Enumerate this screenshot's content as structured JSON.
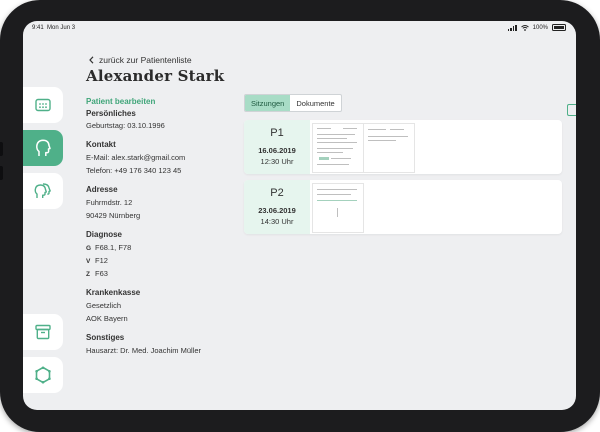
{
  "status": {
    "time": "9:41",
    "date": "Mon Jun 3",
    "battery": "100%"
  },
  "nav": {
    "back_label": "zurück zur Patientenliste",
    "patient_name": "Alexander Stark"
  },
  "sidebar": {
    "items": [
      {
        "icon": "calendar-icon",
        "active": false
      },
      {
        "icon": "head-profile-icon",
        "active": true
      },
      {
        "icon": "people-icon",
        "active": false
      },
      {
        "icon": "archive-box-icon",
        "active": false
      },
      {
        "icon": "hexagon-logo-icon",
        "active": false
      }
    ]
  },
  "info": {
    "edit_label": "Patient bearbeiten",
    "personal": {
      "title": "Persönliches",
      "birthday": "Geburtstag: 03.10.1996"
    },
    "contact": {
      "title": "Kontakt",
      "email": "E-Mail: alex.stark@gmail.com",
      "phone": "Telefon: +49 176 340 123 45"
    },
    "address": {
      "title": "Adresse",
      "street": "Fuhrmdstr. 12",
      "city": "90429 Nürnberg"
    },
    "diagnosis": {
      "title": "Diagnose",
      "items": [
        {
          "key": "G",
          "value": "F68.1, F78"
        },
        {
          "key": "V",
          "value": "F12"
        },
        {
          "key": "Z",
          "value": "F63"
        }
      ]
    },
    "insurance": {
      "title": "Krankenkasse",
      "type": "Gesetzlich",
      "provider": "AOK Bayern"
    },
    "other": {
      "title": "Sonstiges",
      "doctor": "Hausarzt: Dr. Med. Joachim Müller"
    }
  },
  "tabs": {
    "sessions": "Sitzungen",
    "documents": "Dokumente",
    "active": "sessions"
  },
  "sessions": [
    {
      "code": "P1",
      "date": "16.06.2019",
      "time": "12:30 Uhr"
    },
    {
      "code": "P2",
      "date": "23.06.2019",
      "time": "14:30 Uhr"
    }
  ],
  "colors": {
    "accent": "#4fb089",
    "accent_text": "#3fa579",
    "tab_active": "#a8dcc6",
    "card_left": "#e6f5ee",
    "background": "#eeeff1"
  }
}
